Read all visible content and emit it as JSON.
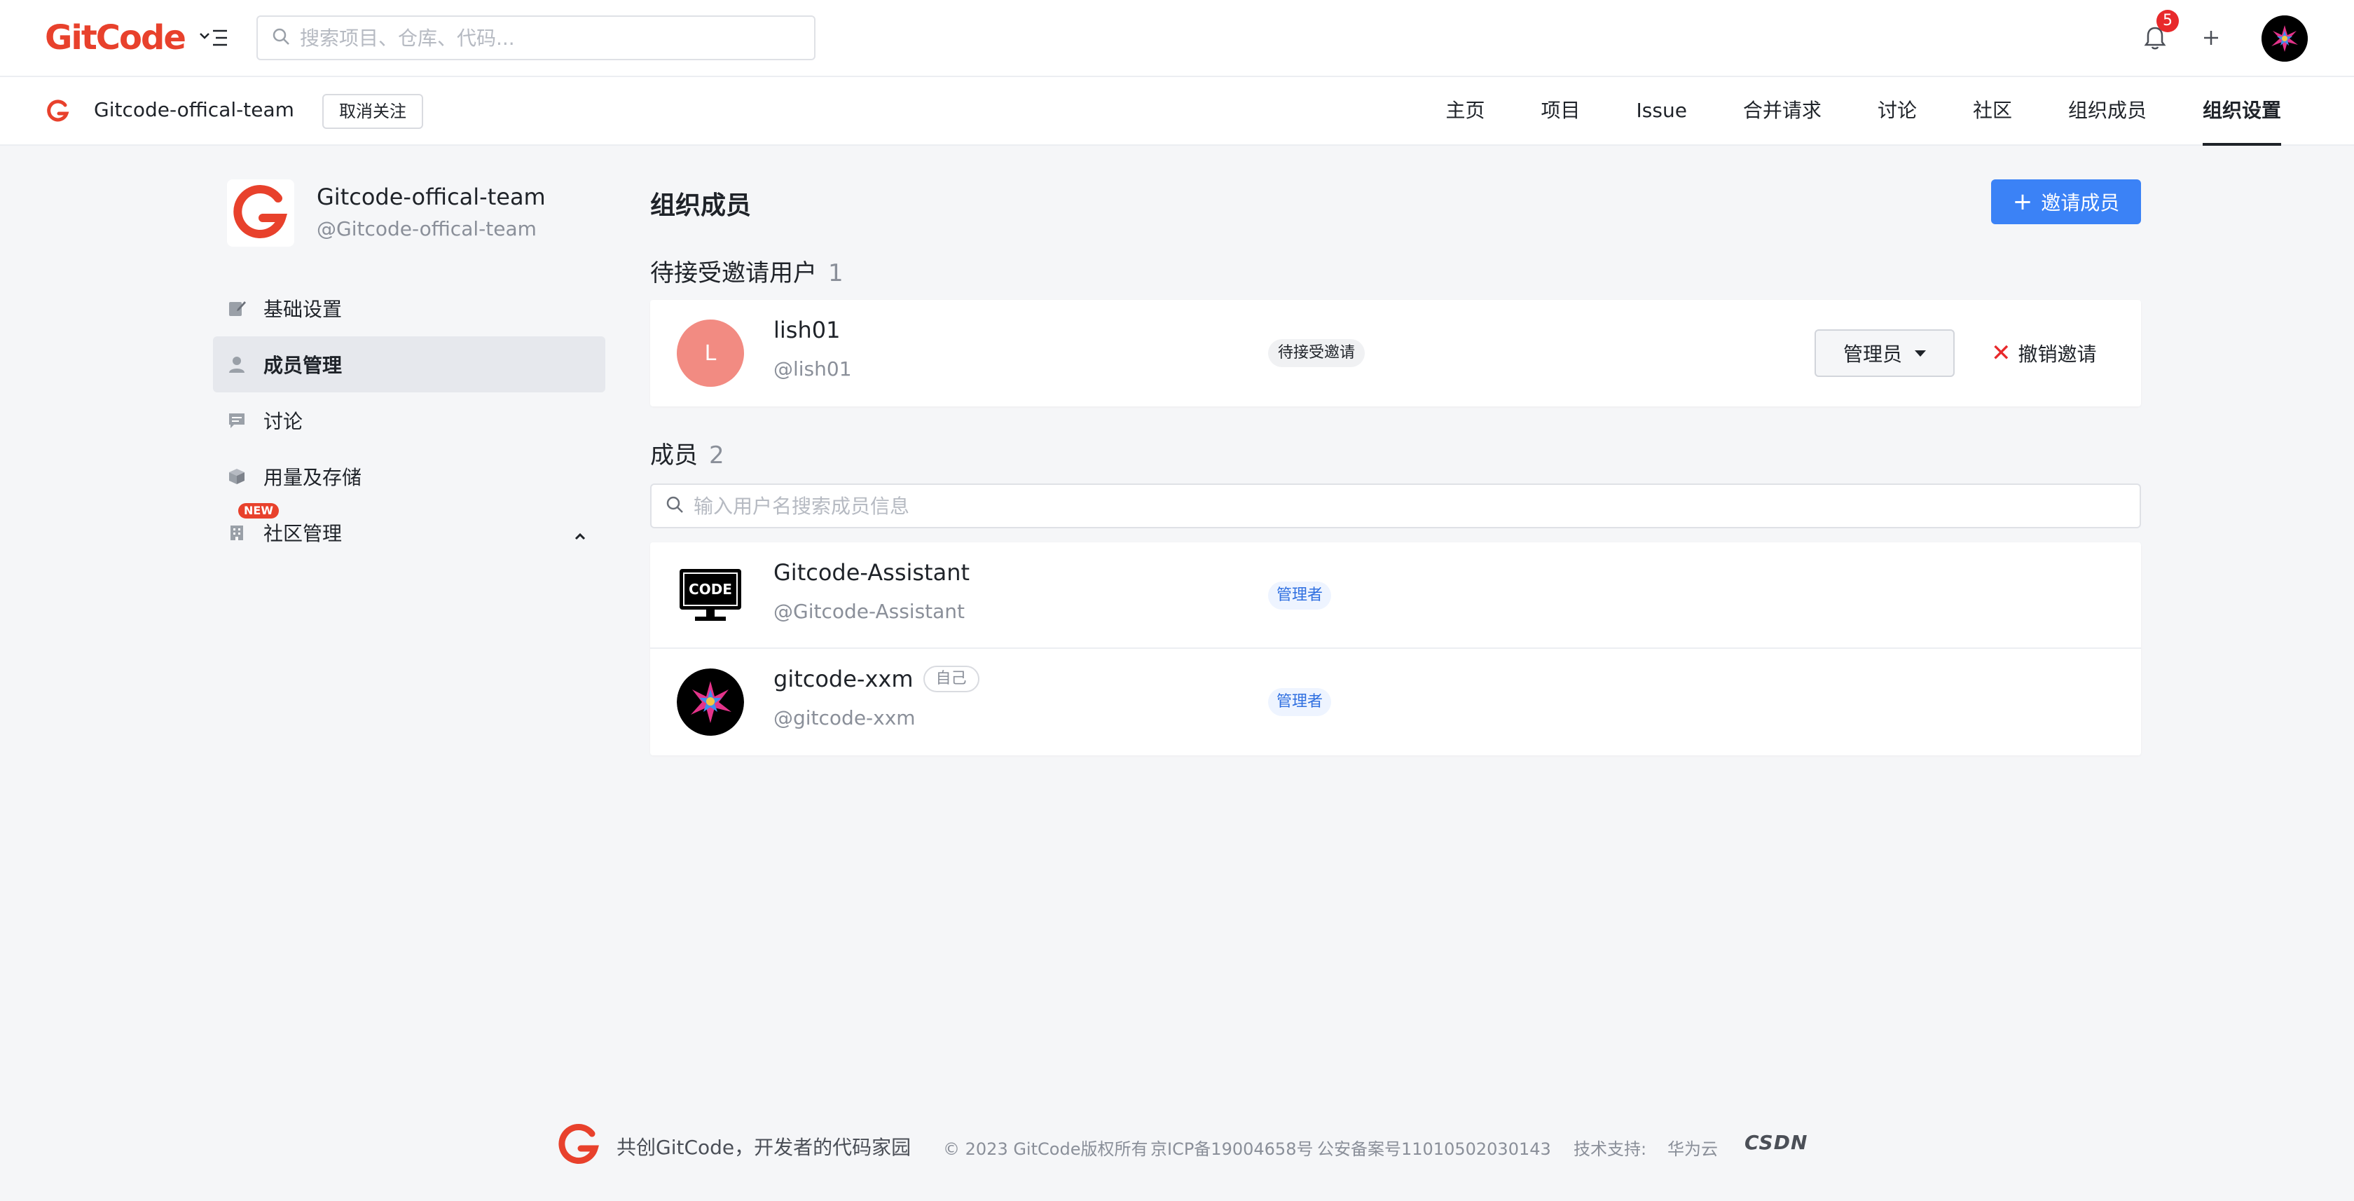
{
  "header": {
    "logo_text": "GitCode",
    "search_placeholder": "搜索项目、仓库、代码...",
    "notification_count": "5"
  },
  "org_bar": {
    "org_name": "Gitcode-offical-team",
    "unfollow_label": "取消关注",
    "nav": [
      "主页",
      "项目",
      "Issue",
      "合并请求",
      "讨论",
      "社区",
      "组织成员",
      "组织设置"
    ],
    "active_nav": "组织设置"
  },
  "sidebar": {
    "org_name": "Gitcode-offical-team",
    "org_handle": "@Gitcode-offical-team",
    "items": [
      {
        "label": "基础设置",
        "icon": "edit-icon"
      },
      {
        "label": "成员管理",
        "icon": "user-icon",
        "active": true
      },
      {
        "label": "讨论",
        "icon": "chat-icon"
      },
      {
        "label": "用量及存储",
        "icon": "box-icon"
      },
      {
        "label": "社区管理",
        "icon": "building-icon",
        "badge": "NEW"
      }
    ]
  },
  "main": {
    "title": "组织成员",
    "invite_button": "邀请成员",
    "pending": {
      "title": "待接受邀请用户",
      "count": "1",
      "users": [
        {
          "initial": "L",
          "name": "lish01",
          "handle": "@lish01",
          "status": "待接受邀请",
          "role": "管理员",
          "revoke": "撤销邀请"
        }
      ]
    },
    "members": {
      "title": "成员",
      "count": "2",
      "search_placeholder": "输入用户名搜索成员信息",
      "users": [
        {
          "name": "Gitcode-Assistant",
          "handle": "@Gitcode-Assistant",
          "role": "管理者",
          "avatar_text": "CODE"
        },
        {
          "name": "gitcode-xxm",
          "handle": "@gitcode-xxm",
          "role": "管理者",
          "self_tag": "自己"
        }
      ]
    }
  },
  "footer": {
    "slogan": "共创GitCode，开发者的代码家园",
    "copyright": "© 2023 GitCode版权所有",
    "icp": "京ICP备19004658号",
    "police": "公安备案号11010502030143",
    "support_label": "技术支持:",
    "support_1": "华为云",
    "support_2": "CSDN"
  },
  "colors": {
    "brand": "#e8412c",
    "primary": "#3b82f6",
    "pending_avatar": "#f28b82",
    "danger": "#e8292b"
  }
}
